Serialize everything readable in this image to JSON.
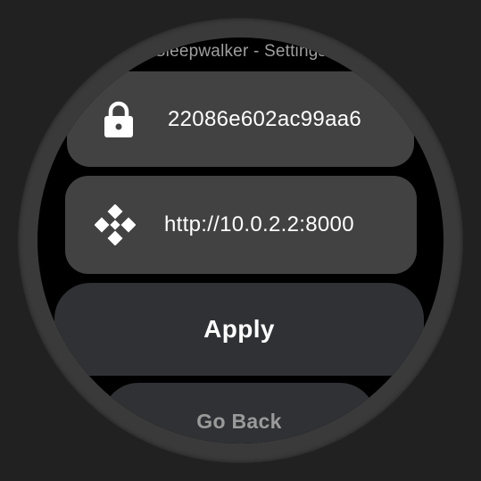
{
  "app": {
    "title": "Sleepwalker - Settings"
  },
  "settings": {
    "secret": {
      "icon": "lock-icon",
      "value": "22086e602ac99aa6"
    },
    "server": {
      "icon": "network-icon",
      "value": "http://10.0.2.2:8000"
    }
  },
  "actions": {
    "apply_label": "Apply",
    "back_label": "Go Back"
  },
  "colors": {
    "background": "#212121",
    "bezel": "#3a3a3a",
    "screen": "#000000",
    "chip": "#424242",
    "button": "#303134",
    "text": "#ffffff",
    "title_text": "#9e9e9e"
  }
}
